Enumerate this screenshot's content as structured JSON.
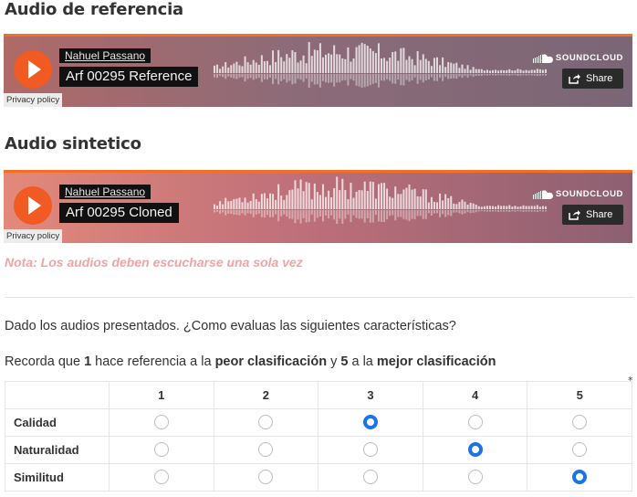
{
  "section_reference": {
    "title": "Audio de referencia"
  },
  "section_synthetic": {
    "title": "Audio sintetico"
  },
  "players": [
    {
      "artist": "Nahuel Passano",
      "track": "Arf 00295 Reference",
      "brand": "SOUNDCLOUD",
      "share_label": "Share",
      "privacy_label": "Privacy policy"
    },
    {
      "artist": "Nahuel Passano",
      "track": "Arf 00295 Cloned",
      "brand": "SOUNDCLOUD",
      "share_label": "Share",
      "privacy_label": "Privacy policy"
    }
  ],
  "note": "Nota: Los audios deben escucharse una sola vez",
  "question": "Dado los audios presentados. ¿Como evaluas las siguientes características?",
  "instruction": {
    "t1": "Recorda que ",
    "n1": "1",
    "t2": " hace referencia a la ",
    "worst": "peor clasificación",
    "t3": " y ",
    "n5": "5",
    "t4": " a la ",
    "best": "mejor clasificación"
  },
  "required_mark": "*",
  "grid": {
    "columns": [
      "1",
      "2",
      "3",
      "4",
      "5"
    ],
    "rows": [
      {
        "label": "Calidad",
        "selected": 3
      },
      {
        "label": "Naturalidad",
        "selected": 4
      },
      {
        "label": "Similitud",
        "selected": 5
      }
    ]
  },
  "colors": {
    "accent_orange": "#f15a22",
    "radio_selected": "#1a73e8",
    "note_pink": "#f4a3a3"
  }
}
